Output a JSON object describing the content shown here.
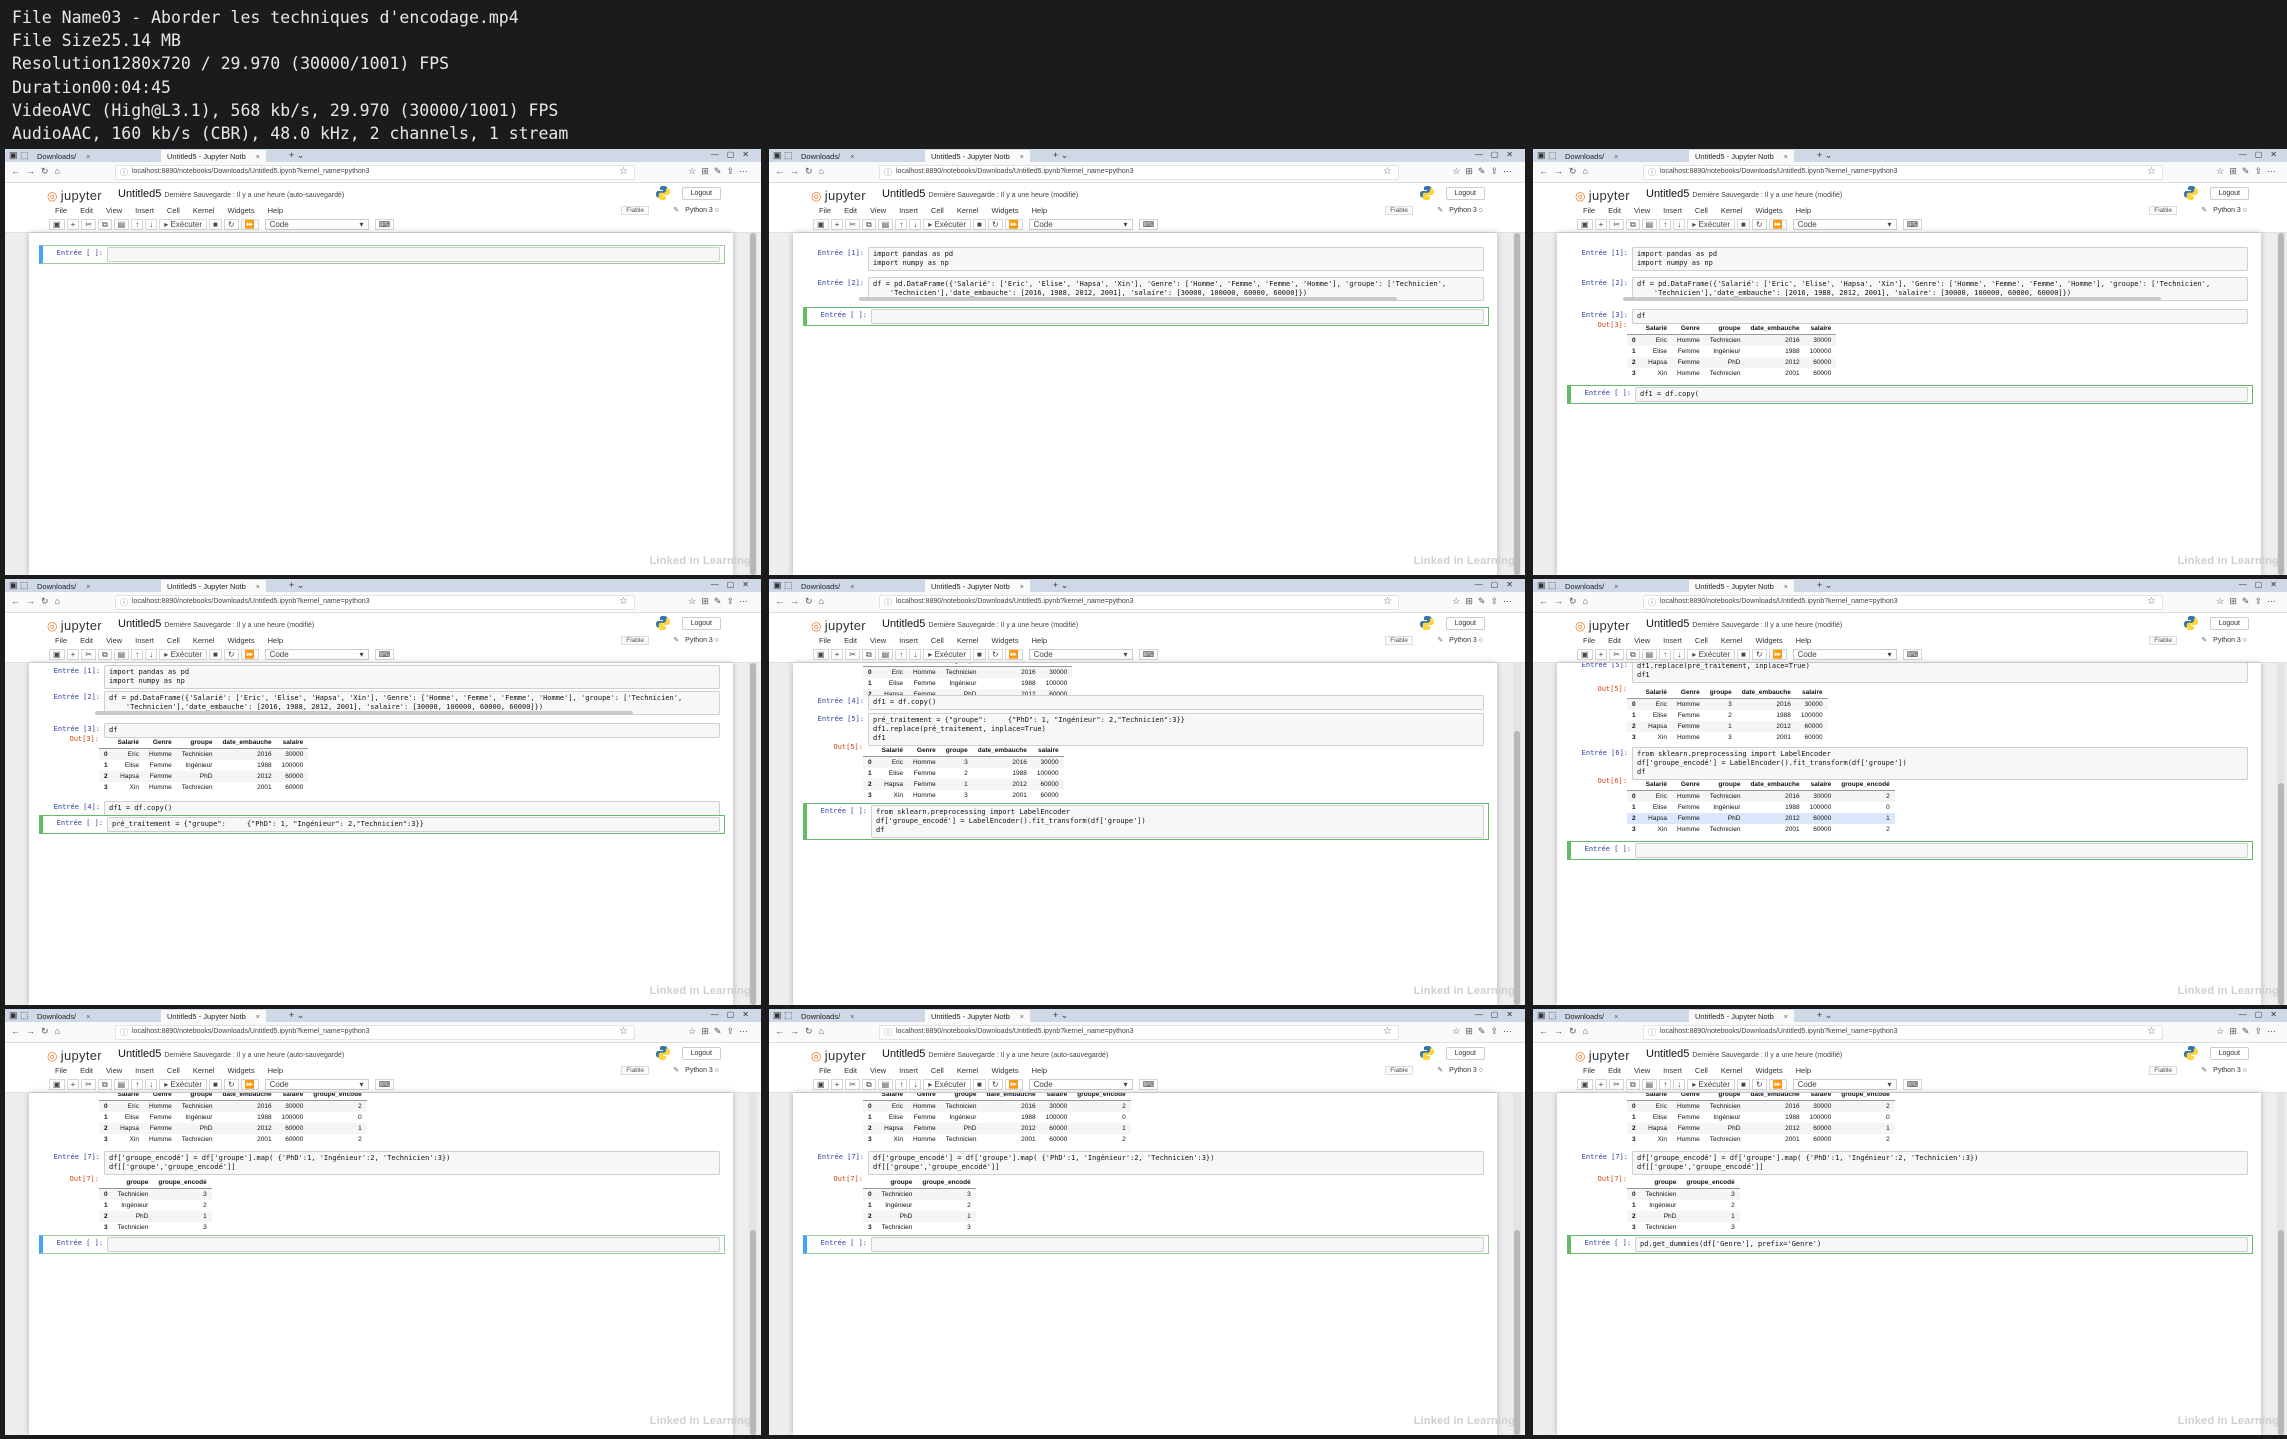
{
  "file_info": [
    {
      "label": "File Name",
      "value": "03 - Aborder les techniques d'encodage.mp4"
    },
    {
      "label": "File Size",
      "value": "25.14 MB"
    },
    {
      "label": "Resolution",
      "value": "1280x720 / 29.970 (30000/1001) FPS"
    },
    {
      "label": "Duration",
      "value": "00:04:45"
    },
    {
      "label": "Video",
      "value": "AVC (High@L3.1), 568 kb/s, 29.970 (30000/1001) FPS"
    },
    {
      "label": "Audio",
      "value": "AAC, 160 kb/s (CBR), 48.0 kHz, 2 channels, 1 stream"
    }
  ],
  "browser": {
    "tab1": "Downloads/",
    "tab2": "Untitled5 - Jupyter Notb",
    "url": "localhost:8890/notebooks/Downloads/Untitled5.ipynb?kernel_name=python3"
  },
  "jupyter": {
    "logo": "jupyter",
    "notebook_name": "Untitled5",
    "saved_autosaved": "Dernière Sauvegarde : Il y a une heure  (auto-sauvegardé)",
    "saved_modified": "Dernière Sauvegarde : Il y a une heure  (modifié)",
    "logout": "Logout",
    "menus": [
      "File",
      "Edit",
      "View",
      "Insert",
      "Cell",
      "Kernel",
      "Widgets",
      "Help"
    ],
    "trusted": "Fiable",
    "kernel": "Python 3",
    "run": "Exécuter",
    "cell_type": "Code"
  },
  "prompts": {
    "in_empty": "Entrée [ ]:",
    "in1": "Entrée [1]:",
    "in2": "Entrée [2]:",
    "in3": "Entrée [3]:",
    "in4": "Entrée [4]:",
    "in5": "Entrée [5]:",
    "in6": "Entrée [6]:",
    "in7": "Entrée [7]:",
    "out3": "Out[3]:",
    "out5": "Out[5]:",
    "out6": "Out[6]:",
    "out7": "Out[7]:"
  },
  "code": {
    "imports_1": "import pandas as pd",
    "imports_2": "import numpy as np",
    "df_1": "df = pd.DataFrame({'Salarié': ['Eric', 'Elise', 'Hapsa', 'Xin'], 'Genre': ['Homme', 'Femme', 'Femme', 'Homme'], 'groupe': ['Technicien',",
    "df_2": "    'Technicien'],'date_embauche': [2016, 1988, 2012, 2001], 'salaire': [30000, 100000, 60000, 60000]})",
    "df_show": "df",
    "copy_partial": "df1 = df.copy(",
    "copy": "df1 = df.copy()",
    "pretr_partial": "pré_traitement = {\"groupe\":     {\"PhD\": 1, \"Ingénieur\": 2,\"Technicien\":3}}",
    "pretr_1": "pré_traitement = {\"groupe\":     {\"PhD\": 1, \"Ingénieur\": 2,\"Technicien\":3}}",
    "pretr_2": "df1.replace(pré_traitement, inplace=True)",
    "pretr_3": "df1",
    "le_1": "from sklearn.preprocessing import LabelEncoder",
    "le_2": "df['groupe_encodé'] = LabelEncoder().fit_transform(df['groupe'])",
    "le_3": "df",
    "map_1": "df['groupe_encodé'] = df['groupe'].map( {'PhD':1, 'Ingénieur':2, 'Technicien':3})",
    "map_2": "df[['groupe','groupe_encodé']]",
    "dummies": "pd.get_dummies(df['Genre'], prefix='Genre')"
  },
  "tables": {
    "df_cols": [
      "",
      "Salarié",
      "Genre",
      "groupe",
      "date_embauche",
      "salaire"
    ],
    "df_rows": [
      [
        "0",
        "Eric",
        "Homme",
        "Technicien",
        "2016",
        "30000"
      ],
      [
        "1",
        "Elise",
        "Femme",
        "Ingénieur",
        "1988",
        "100000"
      ],
      [
        "2",
        "Hapsa",
        "Femme",
        "PhD",
        "2012",
        "60000"
      ],
      [
        "3",
        "Xin",
        "Homme",
        "Technicien",
        "2001",
        "60000"
      ]
    ],
    "df1_rows": [
      [
        "0",
        "Eric",
        "Homme",
        "3",
        "2016",
        "30000"
      ],
      [
        "1",
        "Elise",
        "Femme",
        "2",
        "1988",
        "100000"
      ],
      [
        "2",
        "Hapsa",
        "Femme",
        "1",
        "2012",
        "60000"
      ],
      [
        "3",
        "Xin",
        "Homme",
        "3",
        "2001",
        "60000"
      ]
    ],
    "enc_cols": [
      "",
      "Salarié",
      "Genre",
      "groupe",
      "date_embauche",
      "salaire",
      "groupe_encodé"
    ],
    "enc_rows": [
      [
        "0",
        "Eric",
        "Homme",
        "Technicien",
        "2016",
        "30000",
        "2"
      ],
      [
        "1",
        "Elise",
        "Femme",
        "Ingénieur",
        "1988",
        "100000",
        "0"
      ],
      [
        "2",
        "Hapsa",
        "Femme",
        "PhD",
        "2012",
        "60000",
        "1"
      ],
      [
        "3",
        "Xin",
        "Homme",
        "Technicien",
        "2001",
        "60000",
        "2"
      ]
    ],
    "map_cols": [
      "",
      "groupe",
      "groupe_encodé"
    ],
    "map_rows": [
      [
        "0",
        "Technicien",
        "3"
      ],
      [
        "1",
        "Ingénieur",
        "2"
      ],
      [
        "2",
        "PhD",
        "1"
      ],
      [
        "3",
        "Technicien",
        "3"
      ]
    ]
  },
  "watermark": "Linked in Learning",
  "colors": {
    "accent_blue": "#42a5f5",
    "edit_green": "#66bb6a",
    "jupyter_orange": "#f37726",
    "prompt_in": "#303f9f",
    "prompt_out": "#d84315"
  }
}
